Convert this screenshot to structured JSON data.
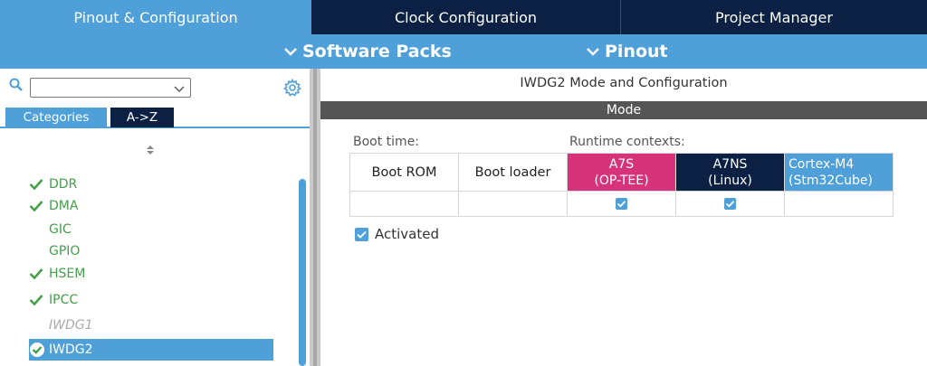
{
  "top_tabs": [
    {
      "label": "Pinout & Configuration"
    },
    {
      "label": "Clock Configuration"
    },
    {
      "label": "Project Manager"
    }
  ],
  "sub_bar": {
    "software_packs": "Software Packs",
    "pinout": "Pinout"
  },
  "left_panel": {
    "search_value": "",
    "tabs": {
      "categories": "Categories",
      "az": "A->Z"
    },
    "items": [
      {
        "label": "DDR",
        "state": "checked"
      },
      {
        "label": "DMA",
        "state": "checked"
      },
      {
        "label": "GIC",
        "state": "plain"
      },
      {
        "label": "GPIO",
        "state": "plain"
      },
      {
        "label": "HSEM",
        "state": "checked"
      },
      {
        "label": "IPCC",
        "state": "checked"
      },
      {
        "label": "IWDG1",
        "state": "disabled"
      },
      {
        "label": "IWDG2",
        "state": "selected"
      }
    ]
  },
  "right_panel": {
    "title": "IWDG2 Mode and Configuration",
    "mode_header": "Mode",
    "boot_time_label": "Boot time:",
    "runtime_contexts_label": "Runtime contexts:",
    "columns": {
      "boot_rom": "Boot ROM",
      "boot_loader": "Boot loader",
      "a7s_line1": "A7S",
      "a7s_line2": "(OP-TEE)",
      "a7ns_line1": "A7NS",
      "a7ns_line2": "(Linux)",
      "m4_line1": "Cortex-M4",
      "m4_line2": "(Stm32Cube)"
    },
    "checkbox_row": {
      "boot_rom": false,
      "boot_loader": false,
      "a7s": true,
      "a7ns": true,
      "cortex_m4": false
    },
    "activated_label": "Activated",
    "activated": true
  },
  "colors": {
    "dark_navy": "#0b2043",
    "accent_blue": "#4fa0d9",
    "magenta": "#d6337a",
    "green_check": "#44a04a",
    "mode_bar_gray": "#555555"
  }
}
